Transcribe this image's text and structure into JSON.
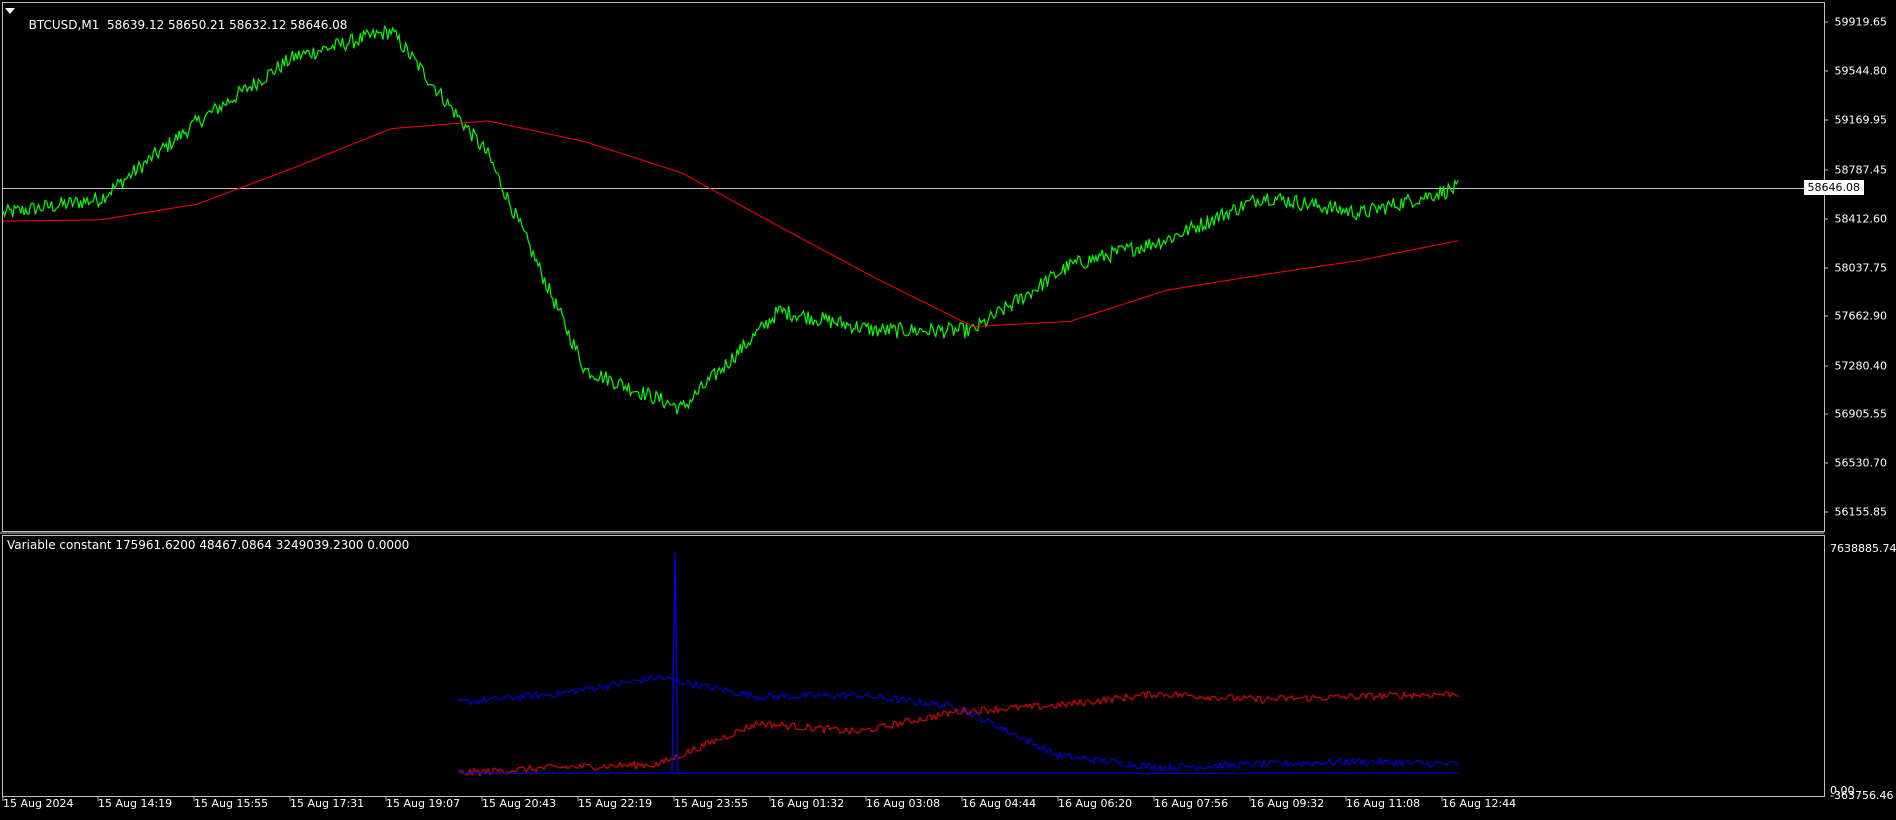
{
  "main_chart": {
    "symbol_timeframe": "BTCUSD,M1",
    "ohlc": "58639.12 58650.21 58632.12 58646.08",
    "current_price": "58646.08",
    "price_axis": [
      "59919.65",
      "59544.80",
      "59169.95",
      "58787.45",
      "58412.60",
      "58037.75",
      "57662.90",
      "57280.40",
      "56905.55",
      "56530.70",
      "56155.85"
    ],
    "price_color": "#00ff00",
    "ma_color": "#ff0000",
    "grid": false
  },
  "indicator": {
    "title": "Variable constant 175961.6200 48467.0864 3249039.2300 0.0000",
    "axis": [
      "7638885.74",
      "0.00",
      "-363756.46"
    ],
    "colors": {
      "blue": "#0000ff",
      "red": "#ff0000"
    }
  },
  "time_axis": [
    "15 Aug 2024",
    "15 Aug 14:19",
    "15 Aug 15:55",
    "15 Aug 17:31",
    "15 Aug 19:07",
    "15 Aug 20:43",
    "15 Aug 22:19",
    "15 Aug 23:55",
    "16 Aug 01:32",
    "16 Aug 03:08",
    "16 Aug 04:44",
    "16 Aug 06:20",
    "16 Aug 07:56",
    "16 Aug 09:32",
    "16 Aug 11:08",
    "16 Aug 12:44"
  ],
  "chart_data": [
    {
      "type": "line",
      "x": [
        "15 Aug 2024",
        "15 Aug 14:19",
        "15 Aug 15:55",
        "15 Aug 17:31",
        "15 Aug 19:07",
        "15 Aug 20:43",
        "15 Aug 22:19",
        "15 Aug 23:55",
        "16 Aug 01:32",
        "16 Aug 03:08",
        "16 Aug 04:44",
        "16 Aug 06:20",
        "16 Aug 07:56",
        "16 Aug 09:32",
        "16 Aug 11:08",
        "16 Aug 12:44"
      ],
      "series": [
        {
          "name": "BTCUSD,M1",
          "values": [
            58450,
            58560,
            59150,
            59650,
            59850,
            58900,
            57250,
            56950,
            57700,
            57550,
            57550,
            58050,
            58250,
            58580,
            58450,
            58646
          ]
        },
        {
          "values": [
            58390,
            58400,
            58520,
            58800,
            59100,
            59160,
            59000,
            58760,
            58350,
            57950,
            57580,
            57620,
            57860,
            57980,
            58090,
            58240
          ]
        }
      ],
      "ylim": [
        56155.85,
        60000
      ],
      "grid": false
    },
    {
      "type": "line",
      "x": [
        "15 Aug 20:43",
        "15 Aug 22:19",
        "15 Aug 23:55",
        "16 Aug 01:32",
        "16 Aug 03:08",
        "16 Aug 04:44",
        "16 Aug 06:20",
        "16 Aug 07:56",
        "16 Aug 09:32",
        "16 Aug 11:08",
        "16 Aug 12:44"
      ],
      "series": [
        {
          "values": [
            2400000,
            2700000,
            3250000,
            2600000,
            2650000,
            2250000,
            600000,
            200000,
            300000,
            400000,
            300000
          ]
        },
        {
          "values": [
            0,
            200000,
            300000,
            1700000,
            1400000,
            2100000,
            2300000,
            2700000,
            2500000,
            2600000,
            2700000
          ]
        }
      ],
      "ylim": [
        -363756.46,
        7638885.74
      ]
    }
  ]
}
